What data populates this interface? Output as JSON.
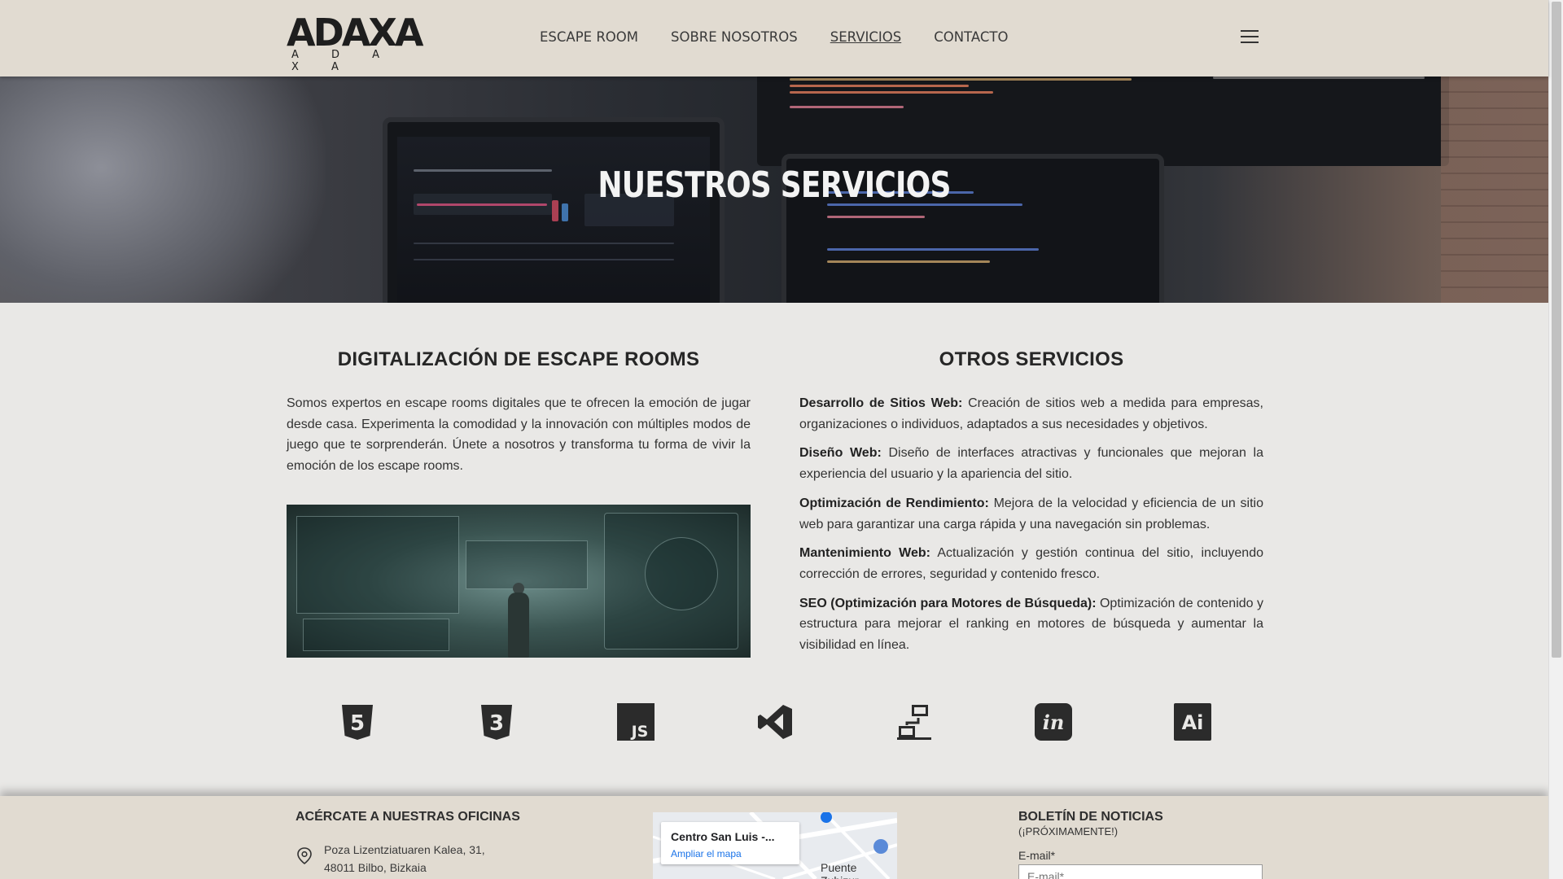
{
  "brand": {
    "logo_text": "ADAXA",
    "logo_subtext": "A D A X A"
  },
  "nav": {
    "items": [
      {
        "label": "ESCAPE ROOM",
        "active": false
      },
      {
        "label": "SOBRE NOSOTROS",
        "active": false
      },
      {
        "label": "SERVICIOS",
        "active": true
      },
      {
        "label": "CONTACTO",
        "active": false
      }
    ],
    "menu_icon": "hamburger-menu-icon"
  },
  "hero": {
    "title": "NUESTROS SERVICIOS"
  },
  "escape_rooms": {
    "title": "DIGITALIZACIÓN DE ESCAPE ROOMS",
    "text": "Somos expertos en escape rooms digitales que te ofrecen la emoción de jugar desde casa. Experimenta la comodidad y la innovación con múltiples modos de juego que te sorprenderán. Únete a nosotros y transforma tu forma de vivir la emoción de los escape rooms."
  },
  "other_services": {
    "title": "OTROS SERVICIOS",
    "items": [
      {
        "name": "Desarrollo de Sitios Web:",
        "description": " Creación de sitios web a medida para empresas, organizaciones o individuos, adaptados a sus necesidades y objetivos."
      },
      {
        "name": "Diseño Web:",
        "description": " Diseño de interfaces atractivas y funcionales que mejoran la experiencia del usuario y la apariencia del sitio."
      },
      {
        "name": "Optimización de Rendimiento:",
        "description": " Mejora de la velocidad y eficiencia de un sitio web para garantizar una carga rápida y una navegación sin problemas."
      },
      {
        "name": "Mantenimiento Web:",
        "description": " Actualización y gestión continua del sitio, incluyendo corrección de errores, seguridad y contenido fresco."
      },
      {
        "name": "SEO (Optimización para Motores de Búsqueda):",
        "description": " Optimización de contenido y estructura para mejorar el ranking en motores de búsqueda y aumentar la visibilidad en línea."
      }
    ]
  },
  "tech_icons": {
    "html5": "5",
    "css3": "3",
    "js": "JS",
    "invision": "in",
    "illustrator": "Ai"
  },
  "footer": {
    "offices_title": "ACÉRCATE A NUESTRAS OFICINAS",
    "address_line1": "Poza Lizentziatuaren Kalea, 31,",
    "address_line2": "48011 Bilbo, Bizkaia",
    "map_place": "Centro San Luis -...",
    "map_link": "Ampliar el mapa",
    "map_label": "Puente Zubizur",
    "newsletter_title": "BOLETÍN DE NOTICIAS",
    "newsletter_subtitle": "(¡PRÓXIMAMENTE!)",
    "email_label": "E-mail*",
    "email_placeholder": "E-mail*"
  },
  "colors": {
    "header_bg": "#e1dbd1",
    "page_bg": "#e9e8e6",
    "icon_color": "#2b2b2b"
  }
}
